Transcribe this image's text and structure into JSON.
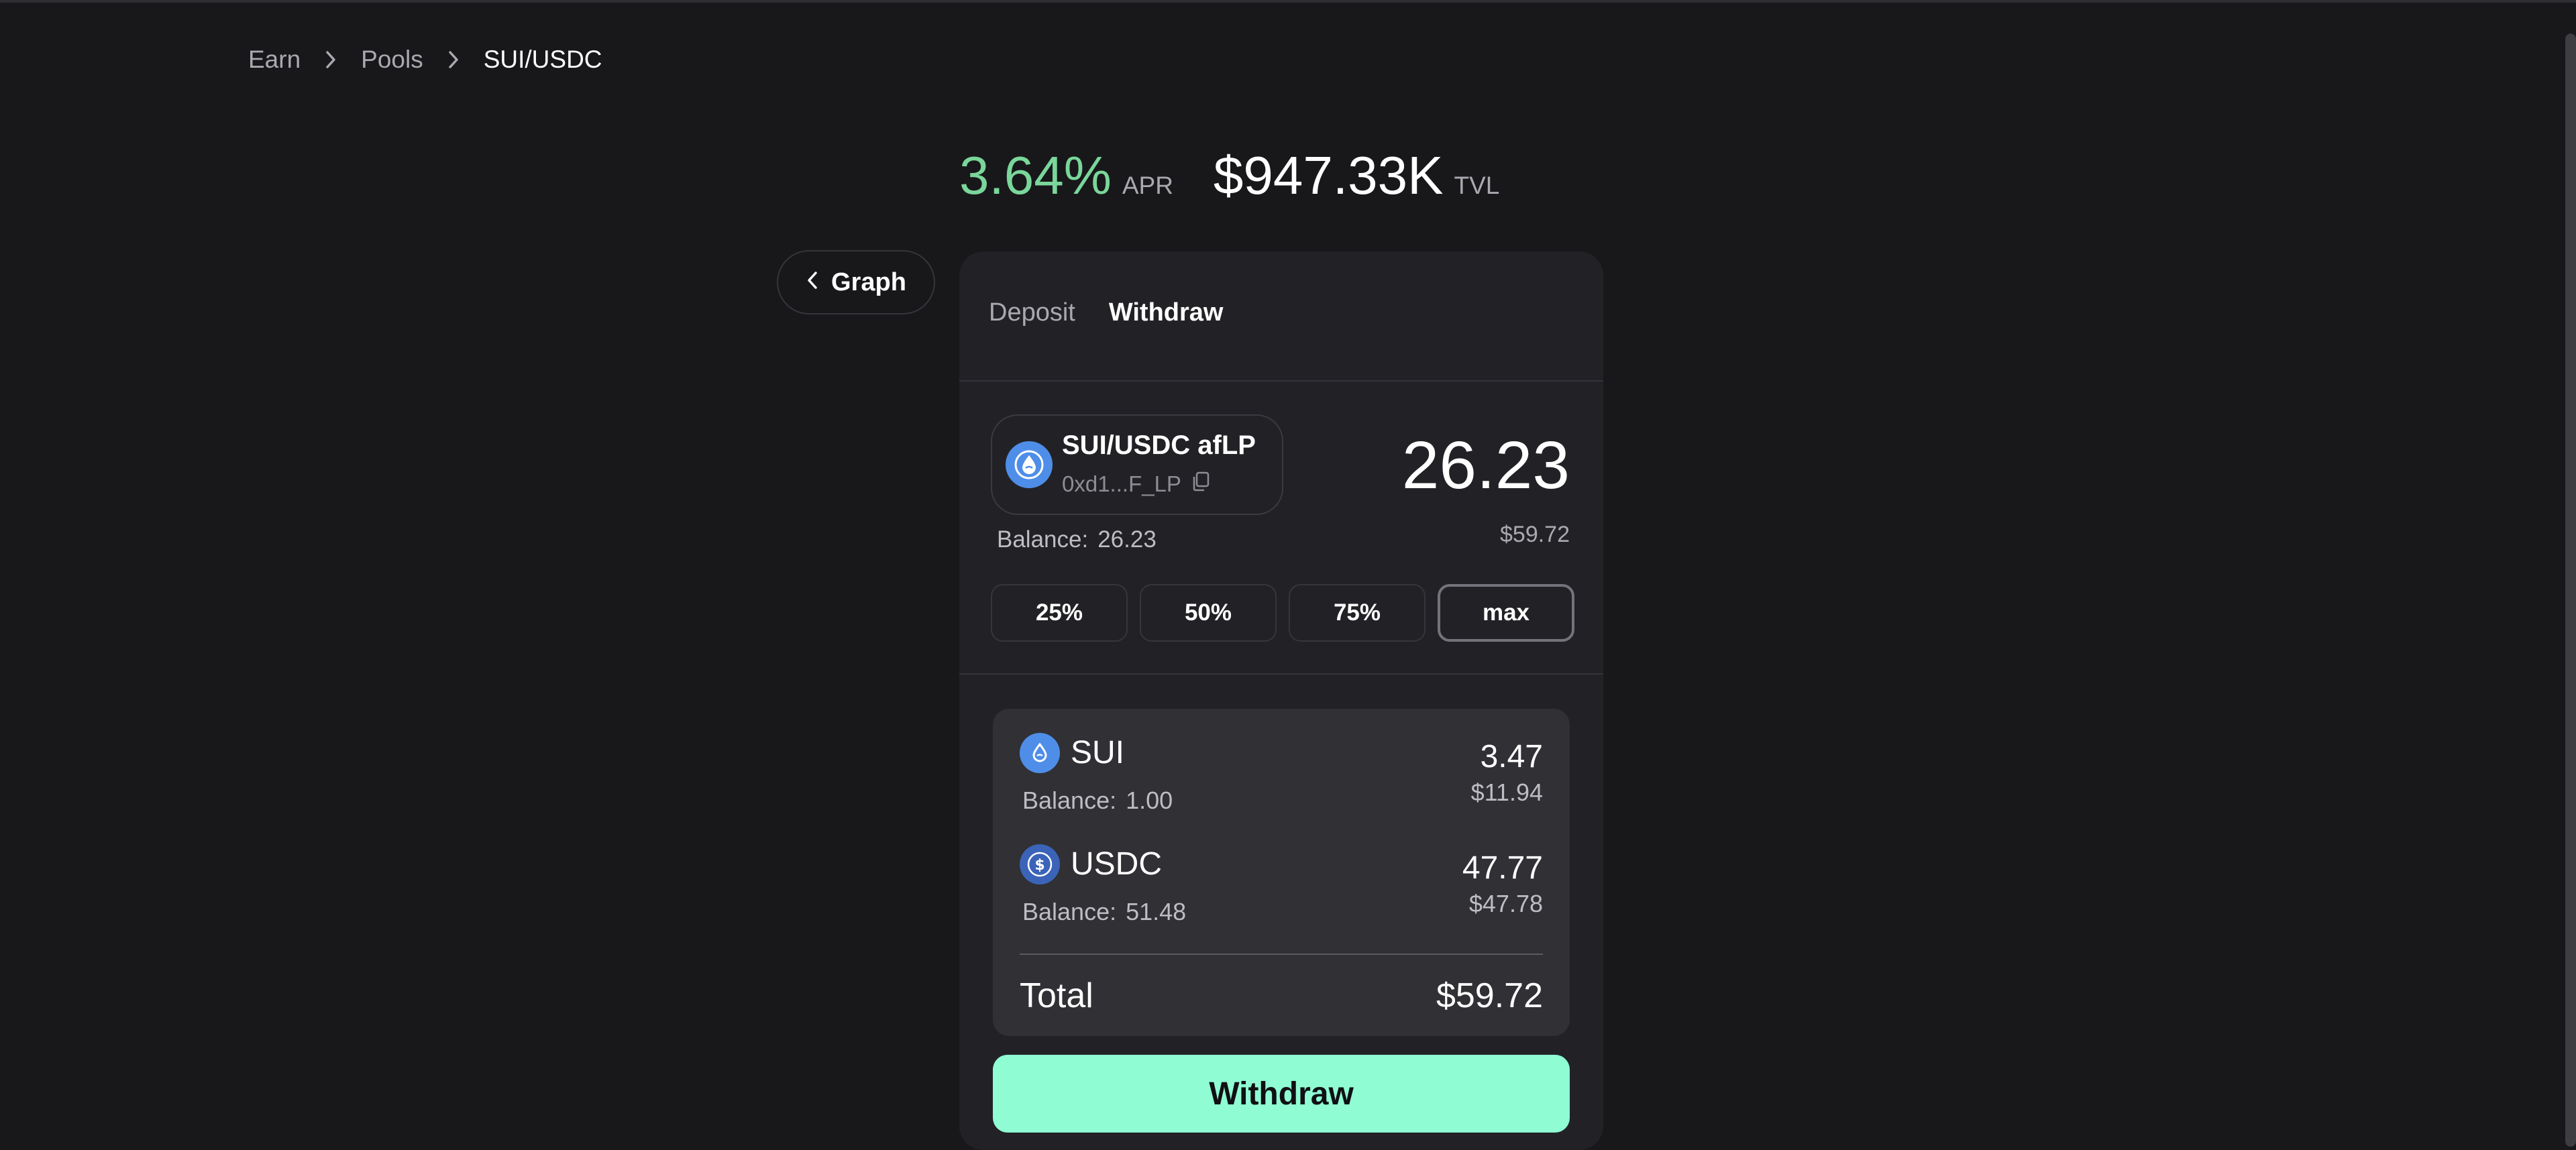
{
  "breadcrumb": {
    "items": [
      "Earn",
      "Pools",
      "SUI/USDC"
    ]
  },
  "stats": {
    "apr_value": "3.64%",
    "apr_label": "APR",
    "tvl_value": "$947.33K",
    "tvl_label": "TVL"
  },
  "graph_button": {
    "label": "Graph",
    "icon": "chevron-left-icon"
  },
  "tabs": [
    {
      "label": "Deposit",
      "active": false
    },
    {
      "label": "Withdraw",
      "active": true
    }
  ],
  "lp_token": {
    "name": "SUI/USDC afLP",
    "address": "0xd1...F_LP",
    "icon": "sui-droplet-icon",
    "copy_icon": "copy-icon",
    "balance_label": "Balance:",
    "balance_value": "26.23",
    "amount": "26.23",
    "amount_usd": "$59.72"
  },
  "percent_buttons": [
    "25%",
    "50%",
    "75%",
    "max"
  ],
  "selected_percent": "max",
  "breakdown": {
    "coins": [
      {
        "name": "SUI",
        "icon": "sui-droplet-icon",
        "balance_label": "Balance:",
        "balance_value": "1.00",
        "amount": "3.47",
        "amount_usd": "$11.94"
      },
      {
        "name": "USDC",
        "icon": "usdc-dollar-icon",
        "balance_label": "Balance:",
        "balance_value": "51.48",
        "amount": "47.77",
        "amount_usd": "$47.78"
      }
    ],
    "total_label": "Total",
    "total_value": "$59.72"
  },
  "withdraw_button": {
    "label": "Withdraw"
  },
  "colors": {
    "background": "#18181b",
    "panel": "#222226",
    "inner_panel": "#303035",
    "apr_green": "#7ad69a",
    "accent_mint": "#8ffcd4",
    "sui_blue": "#4f8ee8",
    "usdc_blue": "#3b63b8"
  }
}
